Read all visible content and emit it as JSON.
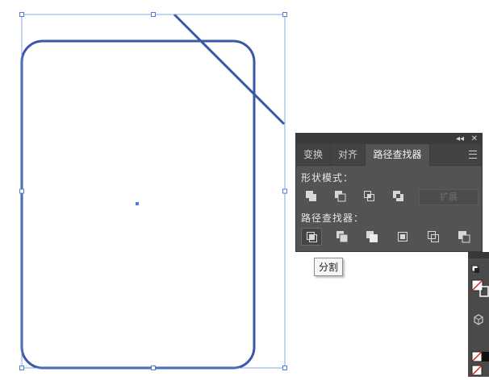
{
  "canvas": {
    "selection_color": "#4a7fd7",
    "shape_stroke_color": "#3a58a8"
  },
  "panel": {
    "collapse_icon": "double-chevron-left-icon",
    "close_icon": "close-icon",
    "tabs": [
      "变换",
      "对齐",
      "路径查找器"
    ],
    "active_tab": "路径查找器",
    "menu_icon": "panel-menu-icon",
    "shape_modes_label": "形状模式：",
    "shape_mode_buttons": [
      "unite-icon",
      "minus-front-icon",
      "intersect-icon",
      "exclude-icon"
    ],
    "expand_label": "扩展",
    "pathfinders_label": "路径查找器：",
    "pathfinder_buttons": [
      "divide-icon",
      "trim-icon",
      "merge-icon",
      "crop-icon",
      "outline-icon",
      "minus-back-icon"
    ]
  },
  "tooltip": {
    "text": "分割"
  }
}
